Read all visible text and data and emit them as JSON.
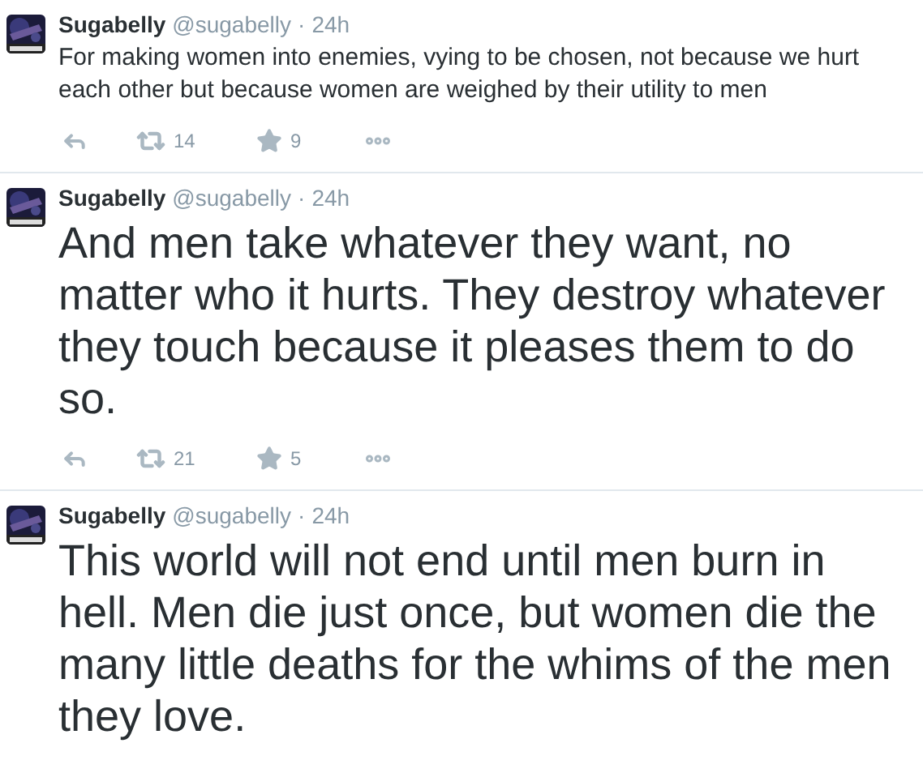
{
  "tweets": [
    {
      "name": "Sugabelly",
      "handle": "@sugabelly",
      "separator": "·",
      "time": "24h",
      "kind": "small",
      "text": "For making women into enemies, vying to be chosen, not because we hurt each other but because women are weighed by their utility to men",
      "retweets": "14",
      "favorites": "9"
    },
    {
      "name": "Sugabelly",
      "handle": "@sugabelly",
      "separator": "·",
      "time": "24h",
      "kind": "large",
      "text": "And men take whatever they want, no matter who it hurts. They destroy whatever they touch because it pleases them to do so.",
      "retweets": "21",
      "favorites": "5"
    },
    {
      "name": "Sugabelly",
      "handle": "@sugabelly",
      "separator": "·",
      "time": "24h",
      "kind": "large",
      "text": "This world will not end until men burn in hell. Men die just once, but women die the many little deaths for the whims of the men they love."
    }
  ]
}
